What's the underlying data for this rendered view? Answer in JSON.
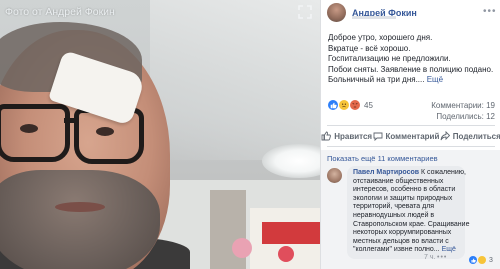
{
  "photo": {
    "credit": "Фото от Андрей Фокин"
  },
  "post": {
    "author_name": "Андрей Фокин",
    "text_lines": [
      "Доброе утро, хорошего дня.",
      "Вкратце - всё хорошо.",
      "Госпитализацию не предложили.",
      "Побои сняты. Заявление в полицию подано.",
      "Больничный на три дня...."
    ],
    "see_more": "Ещё",
    "reactions_count": "45",
    "comments_stat": "Комментарии: 19",
    "shares_stat": "Поделились: 12"
  },
  "actions": {
    "like": "Нравится",
    "comment": "Комментарий",
    "share": "Поделиться"
  },
  "comments": {
    "show_more": "Показать ещё 11 комментариев",
    "items": [
      {
        "author": "Павел Мартиросов",
        "lines": [
          "К сожалению,",
          "отстаивание общественных",
          "интересов, особенно в области",
          "экологии и защиты природных",
          "территорий, чревата для",
          "неравнодушных людей в",
          "Ставропольском крае. Сращивание",
          "некоторых коррумпированных",
          "местных дельцов во власти с",
          "\"коллегами\" извне полно..."
        ],
        "see_more": "Ещё",
        "time": "7 ч.",
        "reactions_count": "3"
      }
    ]
  },
  "colors": {
    "link_blue": "#365899",
    "like_blue": "#2d7ff9",
    "sad_yellow": "#f7c439",
    "angry_orange": "#e4694b"
  },
  "icons": [
    "expand-icon",
    "more-options-icon",
    "like-icon",
    "comment-icon",
    "share-icon",
    "like-reaction-icon",
    "sad-reaction-icon",
    "angry-reaction-icon"
  ]
}
